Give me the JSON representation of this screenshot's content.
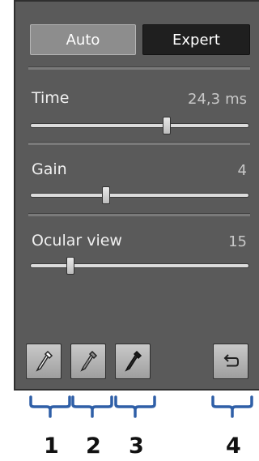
{
  "mode": {
    "auto_label": "Auto",
    "expert_label": "Expert"
  },
  "sliders": [
    {
      "label": "Time",
      "value": "24,3",
      "unit": "ms",
      "fraction": 0.63
    },
    {
      "label": "Gain",
      "value": "4",
      "unit": "",
      "fraction": 0.34
    },
    {
      "label": "Ocular view",
      "value": "15",
      "unit": "",
      "fraction": 0.17
    }
  ],
  "tools": [
    {
      "icon": "eyedropper-icon"
    },
    {
      "icon": "eyedropper-gray-icon"
    },
    {
      "icon": "eyedropper-black-icon"
    },
    {
      "icon": "undo-icon"
    }
  ],
  "callouts": [
    "1",
    "2",
    "3",
    "4"
  ],
  "colors": {
    "panel_bg": "#5a5a5a",
    "bracket": "#2f5fa7"
  }
}
